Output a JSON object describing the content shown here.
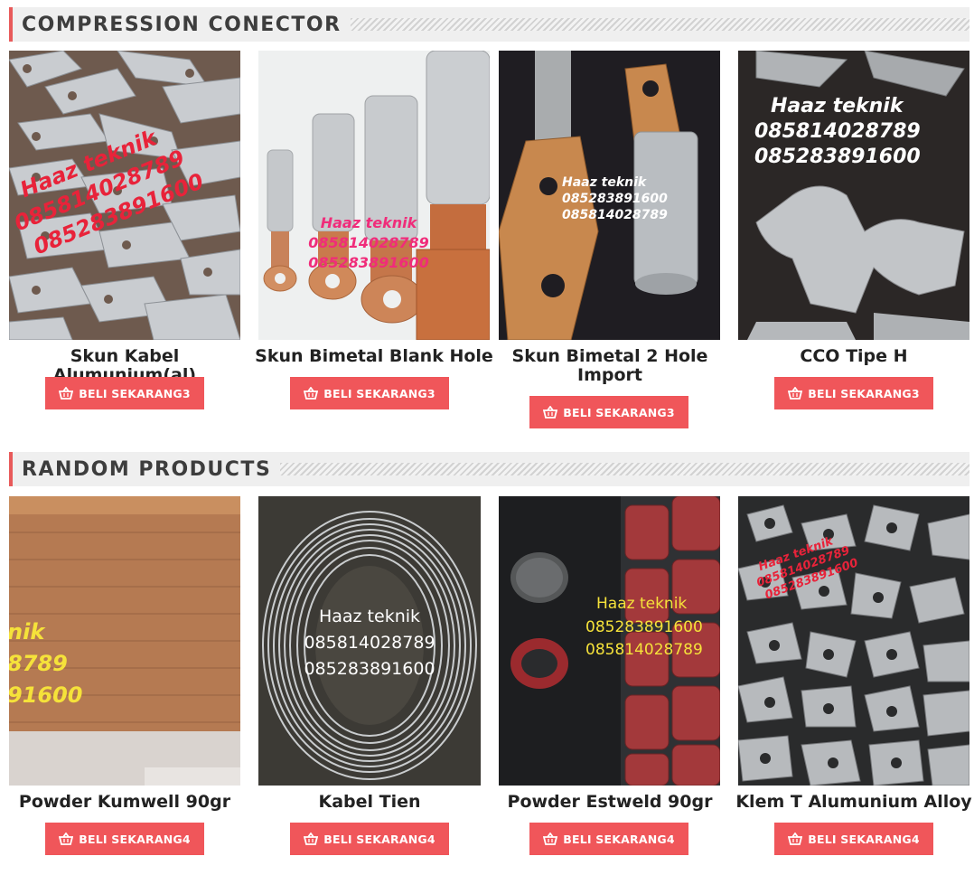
{
  "sections": [
    {
      "title": "COMPRESSION CONECTOR",
      "products": [
        {
          "name": "Skun Kabel Alumunium(al)",
          "button": "BELI SEKARANG3",
          "watermark": [
            "Haaz teknik",
            "085814028789",
            "085283891600"
          ]
        },
        {
          "name": "Skun Bimetal Blank Hole",
          "button": "BELI SEKARANG3",
          "watermark": [
            "Haaz teknik",
            "085814028789",
            "085283891600"
          ]
        },
        {
          "name": "Skun Bimetal 2 Hole Import",
          "button": "BELI SEKARANG3",
          "watermark": [
            "Haaz teknik",
            "085283891600",
            "085814028789"
          ]
        },
        {
          "name": "CCO Tipe H",
          "button": "BELI SEKARANG3",
          "watermark": [
            "Haaz teknik",
            "085814028789",
            "085283891600"
          ]
        }
      ]
    },
    {
      "title": "RANDOM PRODUCTS",
      "products": [
        {
          "name": "Powder Kumwell 90gr",
          "button": "BELI SEKARANG4",
          "watermark": [
            "nik",
            "8789",
            "91600"
          ]
        },
        {
          "name": "Kabel Tien",
          "button": "BELI SEKARANG4",
          "watermark": [
            "Haaz teknik",
            "085814028789",
            "085283891600"
          ]
        },
        {
          "name": "Powder Estweld 90gr",
          "button": "BELI SEKARANG4",
          "watermark": [
            "Haaz teknik",
            "085283891600",
            "085814028789"
          ]
        },
        {
          "name": "Klem T Alumunium Alloy",
          "button": "BELI SEKARANG4",
          "watermark": [
            "Haaz teknik",
            "085814028789",
            "085283891600"
          ]
        }
      ]
    }
  ],
  "colors": {
    "accent": "#f0565a",
    "header_bg": "#efefef",
    "title": "#3d3d3d"
  },
  "icons": {
    "buy_button": "basket-icon"
  }
}
